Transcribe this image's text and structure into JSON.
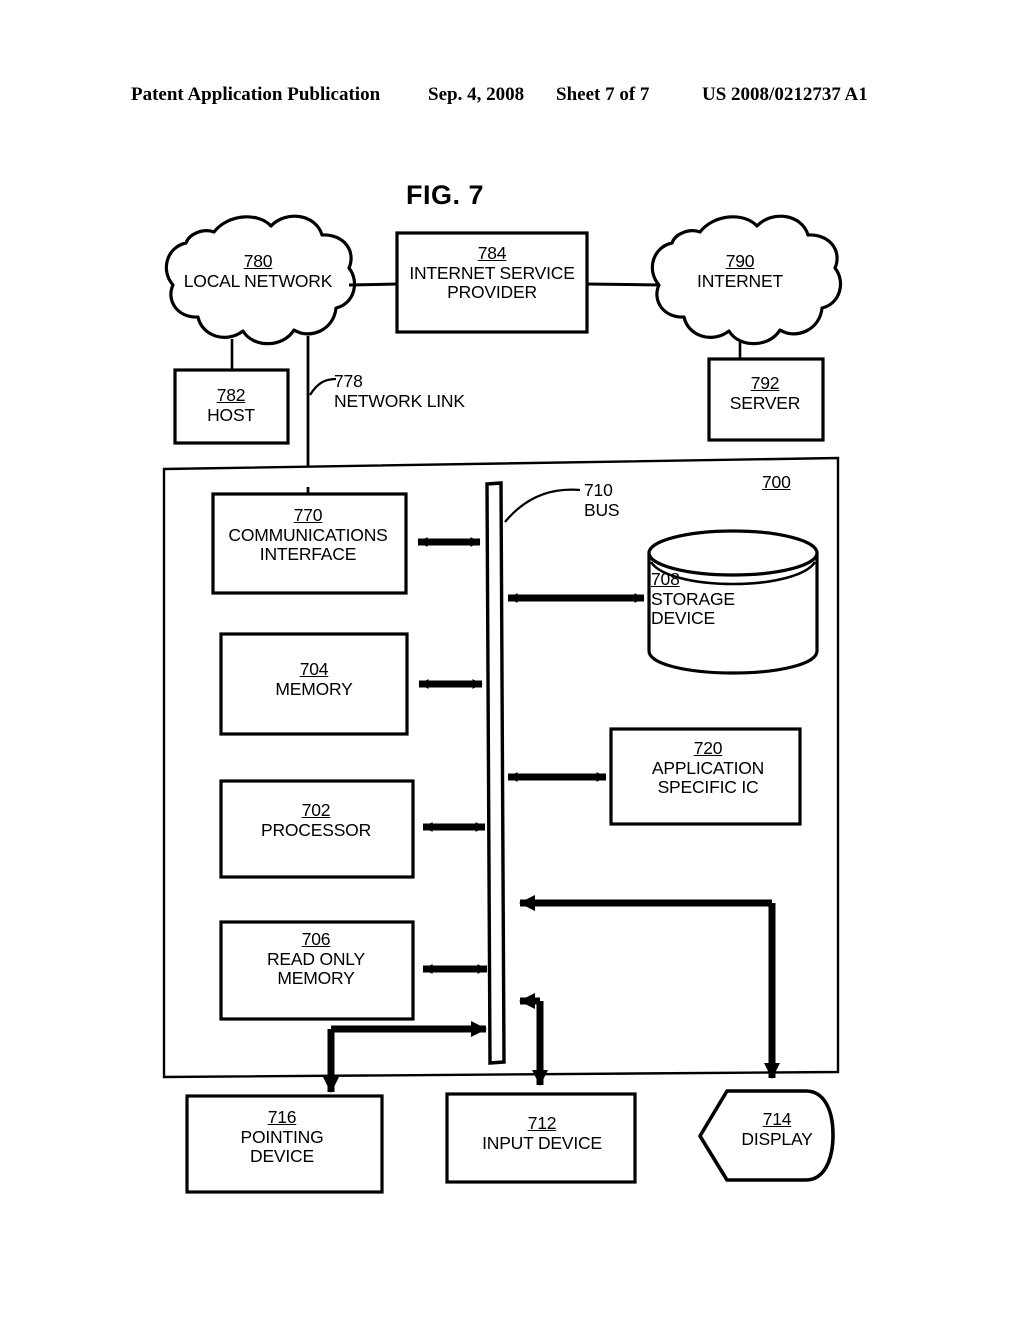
{
  "header": {
    "publication": "Patent Application Publication",
    "date": "Sep. 4, 2008",
    "sheet": "Sheet 7 of 7",
    "number": "US 2008/0212737 A1"
  },
  "figure": {
    "title": "FIG. 7"
  },
  "nodes": {
    "local_network": {
      "ref": "780",
      "caption": "LOCAL NETWORK",
      "shape": "cloud"
    },
    "isp": {
      "ref": "784",
      "caption_line1": "INTERNET SERVICE",
      "caption_line2": "PROVIDER",
      "shape": "rect"
    },
    "internet": {
      "ref": "790",
      "caption": "INTERNET",
      "shape": "cloud"
    },
    "host": {
      "ref": "782",
      "caption": "HOST",
      "shape": "rect"
    },
    "network_link": {
      "ref": "778",
      "caption": "NETWORK LINK",
      "shape": "leader"
    },
    "server": {
      "ref": "792",
      "caption": "SERVER",
      "shape": "rect"
    },
    "computer_system": {
      "ref": "700",
      "caption": "",
      "shape": "rect"
    },
    "communications_interface": {
      "ref": "770",
      "caption_line1": "COMMUNICATIONS",
      "caption_line2": "INTERFACE",
      "shape": "rect"
    },
    "bus": {
      "ref": "710",
      "caption": "BUS",
      "shape": "bar"
    },
    "storage_device": {
      "ref": "708",
      "caption_line1": "STORAGE",
      "caption_line2": "DEVICE",
      "shape": "cylinder"
    },
    "memory": {
      "ref": "704",
      "caption": "MEMORY",
      "shape": "rect"
    },
    "asic": {
      "ref": "720",
      "caption_line1": "APPLICATION",
      "caption_line2": "SPECIFIC IC",
      "shape": "rect"
    },
    "processor": {
      "ref": "702",
      "caption": "PROCESSOR",
      "shape": "rect"
    },
    "read_only_memory": {
      "ref": "706",
      "caption_line1": "READ ONLY",
      "caption_line2": "MEMORY",
      "shape": "rect"
    },
    "pointing_device": {
      "ref": "716",
      "caption_line1": "POINTING",
      "caption_line2": "DEVICE",
      "shape": "rect"
    },
    "input_device": {
      "ref": "712",
      "caption": "INPUT DEVICE",
      "shape": "rect"
    },
    "display": {
      "ref": "714",
      "caption": "DISPLAY",
      "shape": "crt-hexagon"
    }
  },
  "colors": {
    "ink": "#000000",
    "paper": "#ffffff"
  }
}
